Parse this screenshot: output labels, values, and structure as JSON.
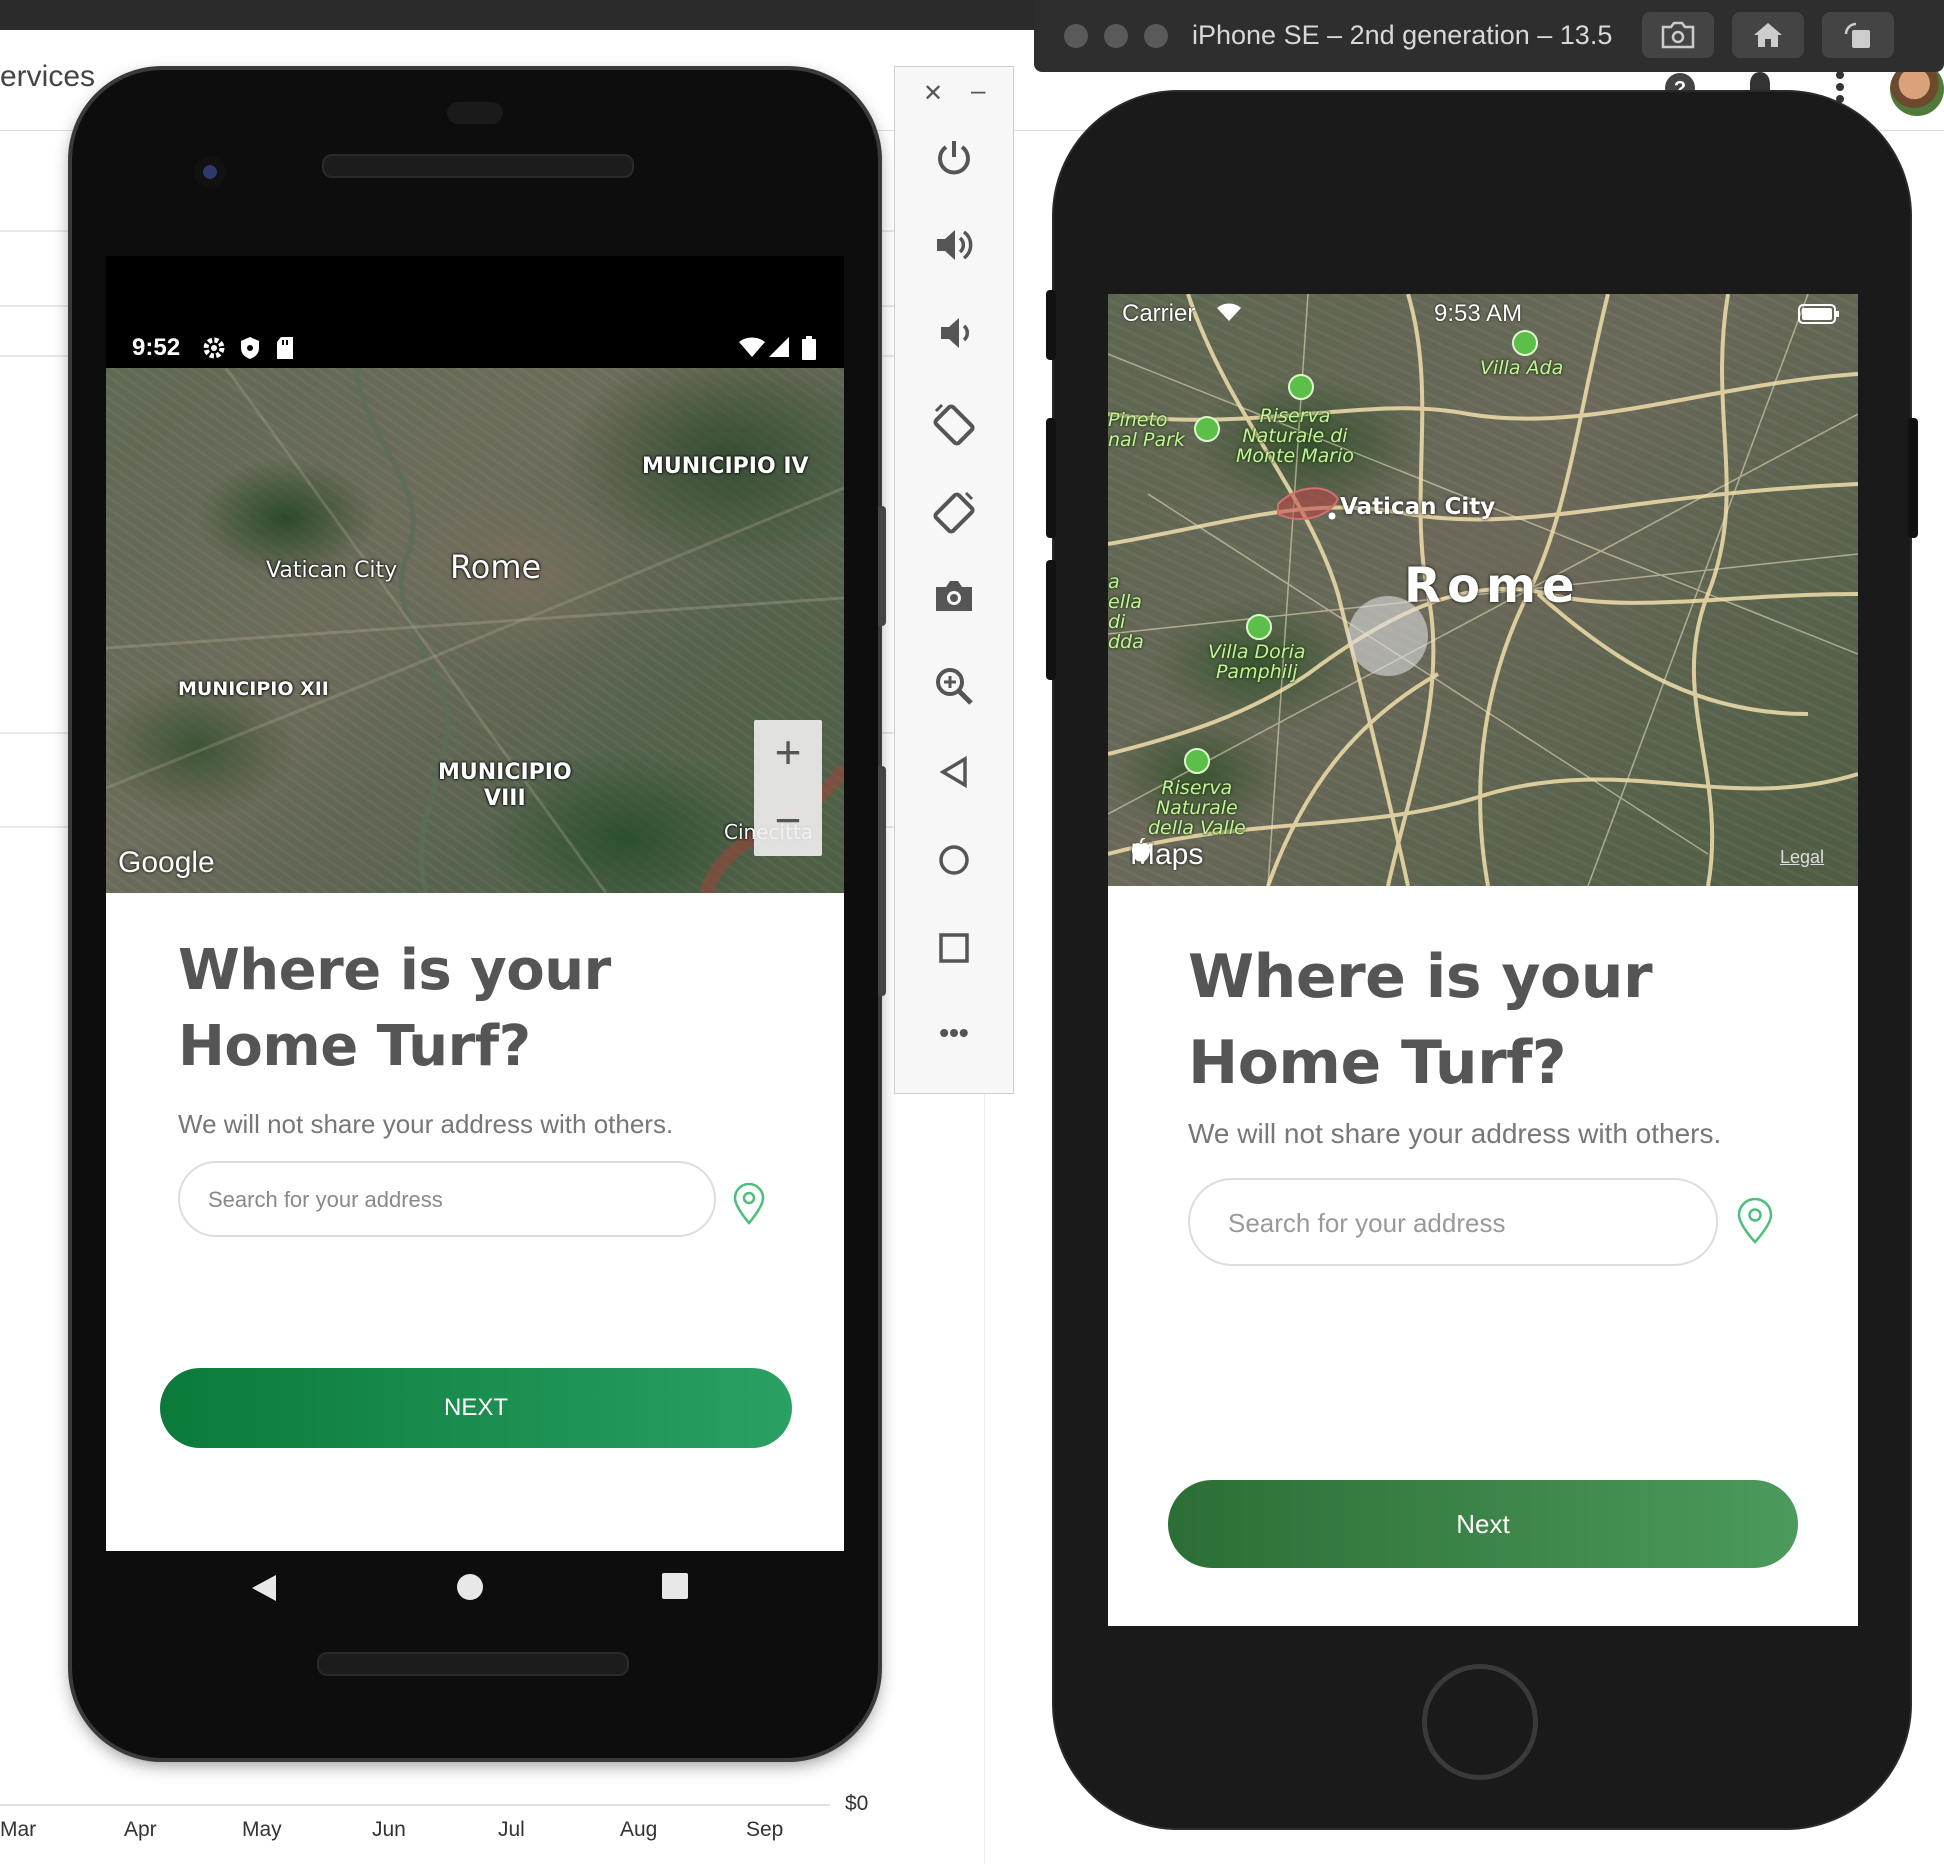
{
  "background": {
    "browser_text": "ervices",
    "chart_months": [
      "Mar",
      "Apr",
      "May",
      "Jun",
      "Jul",
      "Aug",
      "Sep"
    ],
    "chart_y_label": "$0"
  },
  "android": {
    "status": {
      "time": "9:52"
    },
    "map": {
      "labels": {
        "municipio_iv": "MUNICIPIO IV",
        "vatican": "Vatican City",
        "rome": "Rome",
        "municipio_xii": "MUNICIPIO XII",
        "municipio_viii": "MUNICIPIO\nVIII",
        "cinecitta": "Cinecitta",
        "google": "Google"
      },
      "zoom_in": "+",
      "zoom_out": "−"
    },
    "title": "Where is your Home Turf?",
    "subtitle": "We will not share your address with others.",
    "search_placeholder": "Search for your address",
    "next_label": "NEXT"
  },
  "emulator_toolbar": {
    "close": "✕",
    "minimize": "–",
    "more": "•••"
  },
  "ios": {
    "window_title": "iPhone SE – 2nd generation – 13.5",
    "status": {
      "carrier": "Carrier",
      "time": "9:53 AM"
    },
    "map": {
      "labels": {
        "villa_ada": "Villa Ada",
        "pineto": "Pineto\nnal Park",
        "riserva_monte_mario": "Riserva\nNaturale di\nMonte Mario",
        "vatican": "Vatican City",
        "rome": "Rome",
        "villa_doria": "Villa Doria\nPamphilj",
        "riserva_valle": "Riserva\nNaturale\ndella Valle",
        "left_edge": "a\nella\ndi\ndda",
        "maps": "Maps",
        "legal": "Legal"
      }
    },
    "title": "Where is your Home Turf?",
    "subtitle": "We will not share your address with others.",
    "search_placeholder": "Search for your address",
    "next_label": "Next"
  },
  "colors": {
    "android_button_start": "#0b7a3a",
    "android_button_end": "#2aa063",
    "ios_button_start": "#2c6e35",
    "ios_button_end": "#4c9a5c",
    "title_text": "#555555",
    "pin_green": "#4cbf7a"
  }
}
